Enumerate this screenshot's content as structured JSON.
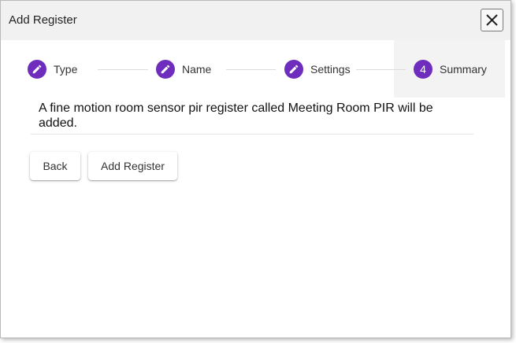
{
  "dialog": {
    "title": "Add Register",
    "close_icon": "close-icon"
  },
  "stepper": {
    "steps": [
      {
        "label": "Type",
        "icon": "pencil-icon",
        "state": "completed"
      },
      {
        "label": "Name",
        "icon": "pencil-icon",
        "state": "completed"
      },
      {
        "label": "Settings",
        "icon": "pencil-icon",
        "state": "completed"
      },
      {
        "label": "Summary",
        "number": "4",
        "state": "active"
      }
    ]
  },
  "summary": {
    "message": "A fine motion room sensor pir register called Meeting Room PIR will be added."
  },
  "actions": {
    "back_label": "Back",
    "add_label": "Add Register"
  },
  "colors": {
    "accent": "#6f2dbd",
    "titlebar_bg": "#f1f1f1",
    "active_step_bg": "#f3f3f3"
  }
}
